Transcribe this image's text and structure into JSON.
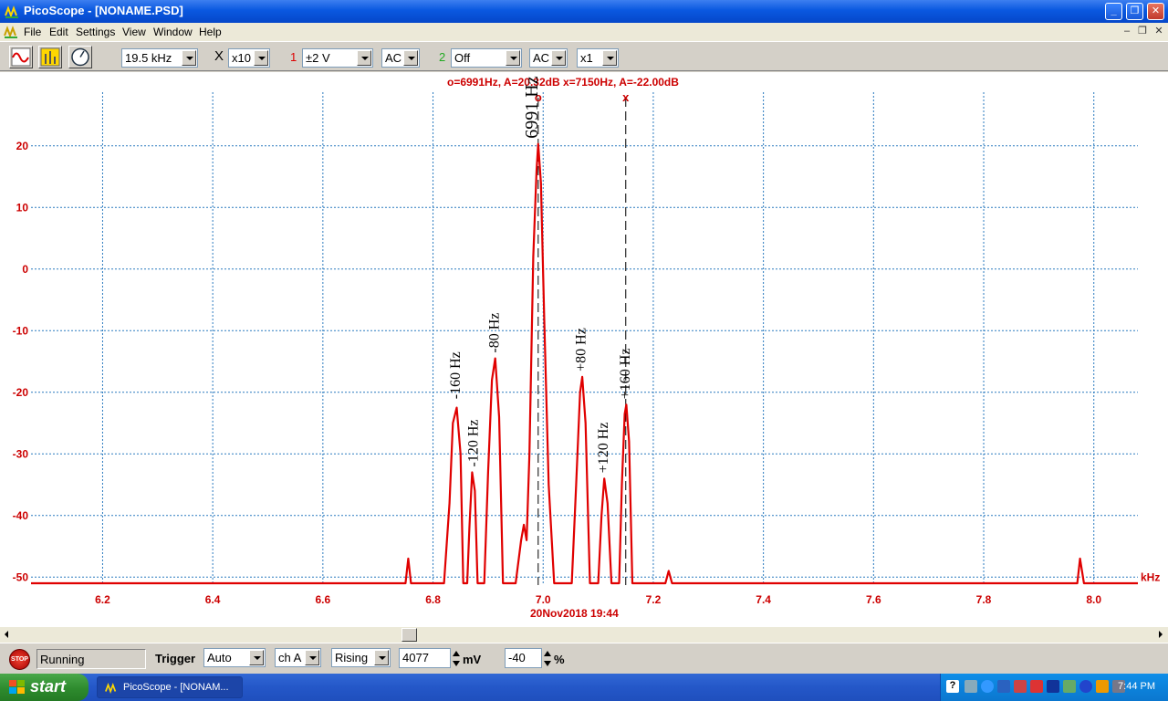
{
  "window": {
    "title": "PicoScope - [NONAME.PSD]"
  },
  "menu": [
    "File",
    "Edit",
    "Settings",
    "View",
    "Window",
    "Help"
  ],
  "toolbar": {
    "freq_range": "19.5 kHz",
    "x_label": "X",
    "x_mult": "x10",
    "ch1_label": "1",
    "ch1_range": "±2 V",
    "ch1_coupling": "AC",
    "ch2_label": "2",
    "ch2_range": "Off",
    "ch2_coupling": "AC",
    "ch2_mult": "x1"
  },
  "plot": {
    "readout": "o=6991Hz, A=20.32dB  x=7150Hz, A=-22.00dB",
    "datestamp": "20Nov2018  19:44",
    "unit_x": "kHz",
    "marker_o": "o",
    "marker_x": "x",
    "annotations": [
      {
        "text": "-160 Hz",
        "f": 6.843,
        "db": -22
      },
      {
        "text": "-120 Hz",
        "f": 6.875,
        "db": -33
      },
      {
        "text": "-80 Hz",
        "f": 6.913,
        "db": -14.5
      },
      {
        "text": "6991 Hz",
        "f": 6.991,
        "db": 20.3
      },
      {
        "text": "+80 Hz",
        "f": 7.071,
        "db": -17.5
      },
      {
        "text": "+120 Hz",
        "f": 7.111,
        "db": -34
      },
      {
        "text": "+160 Hz",
        "f": 7.151,
        "db": -22
      }
    ]
  },
  "chart_data": {
    "type": "line",
    "xlabel": "kHz",
    "ylabel": "",
    "xlim": [
      6.07,
      8.08
    ],
    "ylim": [
      -51,
      29
    ],
    "x_ticks": [
      "6.2",
      "6.4",
      "6.6",
      "6.8",
      "7.0",
      "7.2",
      "7.4",
      "7.6",
      "7.8",
      "8.0"
    ],
    "y_ticks": [
      "20",
      "10",
      "0",
      "-10",
      "-20",
      "-30",
      "-40",
      "-50"
    ],
    "grid": true,
    "color": "#e00000",
    "series": [
      {
        "values": [
          [
            6.07,
            -51
          ],
          [
            6.75,
            -51
          ],
          [
            6.755,
            -47
          ],
          [
            6.76,
            -51
          ],
          [
            6.82,
            -51
          ],
          [
            6.83,
            -38
          ],
          [
            6.836,
            -25
          ],
          [
            6.843,
            -22.5
          ],
          [
            6.85,
            -30
          ],
          [
            6.855,
            -51
          ],
          [
            6.862,
            -51
          ],
          [
            6.866,
            -42
          ],
          [
            6.871,
            -33
          ],
          [
            6.876,
            -36
          ],
          [
            6.881,
            -51
          ],
          [
            6.893,
            -51
          ],
          [
            6.9,
            -33
          ],
          [
            6.907,
            -18
          ],
          [
            6.913,
            -14.5
          ],
          [
            6.92,
            -24
          ],
          [
            6.927,
            -51
          ],
          [
            6.95,
            -51
          ],
          [
            6.96,
            -44
          ],
          [
            6.965,
            -41.5
          ],
          [
            6.97,
            -44
          ],
          [
            6.975,
            -30
          ],
          [
            6.982,
            2
          ],
          [
            6.988,
            16
          ],
          [
            6.991,
            20.3
          ],
          [
            6.996,
            14
          ],
          [
            7.002,
            -8
          ],
          [
            7.01,
            -35
          ],
          [
            7.02,
            -51
          ],
          [
            7.052,
            -51
          ],
          [
            7.06,
            -35
          ],
          [
            7.067,
            -20
          ],
          [
            7.071,
            -17.5
          ],
          [
            7.077,
            -25
          ],
          [
            7.085,
            -51
          ],
          [
            7.1,
            -51
          ],
          [
            7.106,
            -40
          ],
          [
            7.111,
            -34
          ],
          [
            7.117,
            -38
          ],
          [
            7.124,
            -51
          ],
          [
            7.138,
            -51
          ],
          [
            7.143,
            -35
          ],
          [
            7.148,
            -23.5
          ],
          [
            7.151,
            -22
          ],
          [
            7.156,
            -28
          ],
          [
            7.162,
            -51
          ],
          [
            7.222,
            -51
          ],
          [
            7.228,
            -49
          ],
          [
            7.234,
            -51
          ],
          [
            7.97,
            -51
          ],
          [
            7.975,
            -47
          ],
          [
            7.982,
            -51
          ],
          [
            8.08,
            -51
          ]
        ]
      }
    ],
    "markers": [
      {
        "symbol": "o",
        "x": 6.991,
        "y": 20.32
      },
      {
        "symbol": "x",
        "x": 7.15,
        "y": -22.0
      }
    ]
  },
  "statusbar": {
    "status": "Running",
    "stop_label": "STOP",
    "trigger_label": "Trigger",
    "trigger_mode": "Auto",
    "trigger_channel": "ch A",
    "trigger_edge": "Rising",
    "trigger_level": "4077",
    "trigger_level_unit": "mV",
    "trigger_delay": "-40",
    "trigger_delay_unit": "%"
  },
  "taskbar": {
    "start_label": "start",
    "task_title": "PicoScope - [NONAM...",
    "clock": "7:44 PM"
  },
  "colors": {
    "trace": "#e00000",
    "grid": "#2a7abf",
    "axis_text": "#cc0000"
  }
}
